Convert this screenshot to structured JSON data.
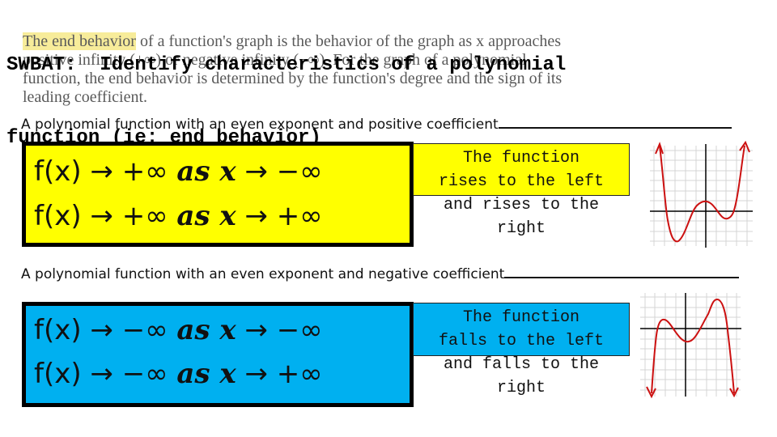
{
  "heading": {
    "line1": "SWBAT:  Identify characteristics of a polynomial",
    "line2": "function (ie: end behavior)"
  },
  "background_text": {
    "highlight": "The end behavior",
    "line1_rest": " of a function's graph is the behavior of the graph as x approaches",
    "line2": "positive infinity (+∞) or negative infinity (−∞). For the graph of a polynomial",
    "line3": "function, the end behavior is determined by the function's degree and the sign of its",
    "line4": "leading coefficient."
  },
  "sections": [
    {
      "prompt": "A polynomial function with an even exponent and positive coefficient",
      "box_color": "#ffff00",
      "equations": [
        {
          "lhs": "f(x) → +∞ ",
          "as": "as x",
          "rhs": " → −∞"
        },
        {
          "lhs": "f(x) → +∞ ",
          "as": "as x",
          "rhs": " → +∞"
        }
      ],
      "description_boxed": [
        "The function",
        "rises to the left"
      ],
      "description_rest": [
        "and rises to the",
        "right"
      ],
      "graph": {
        "type": "line",
        "end_behavior": "rises-rises",
        "curve_color": "#cc1111"
      }
    },
    {
      "prompt": "A polynomial function with an even exponent and negative coefficient",
      "box_color": "#00b0f0",
      "equations": [
        {
          "lhs": "f(x) → −∞ ",
          "as": "as x",
          "rhs": " → −∞"
        },
        {
          "lhs": "f(x) → −∞ ",
          "as": "as x",
          "rhs": " → +∞"
        }
      ],
      "description_boxed": [
        "The function",
        "falls to the left"
      ],
      "description_rest": [
        "and falls to the",
        "right"
      ],
      "graph": {
        "type": "line",
        "end_behavior": "falls-falls",
        "curve_color": "#cc1111"
      }
    }
  ]
}
